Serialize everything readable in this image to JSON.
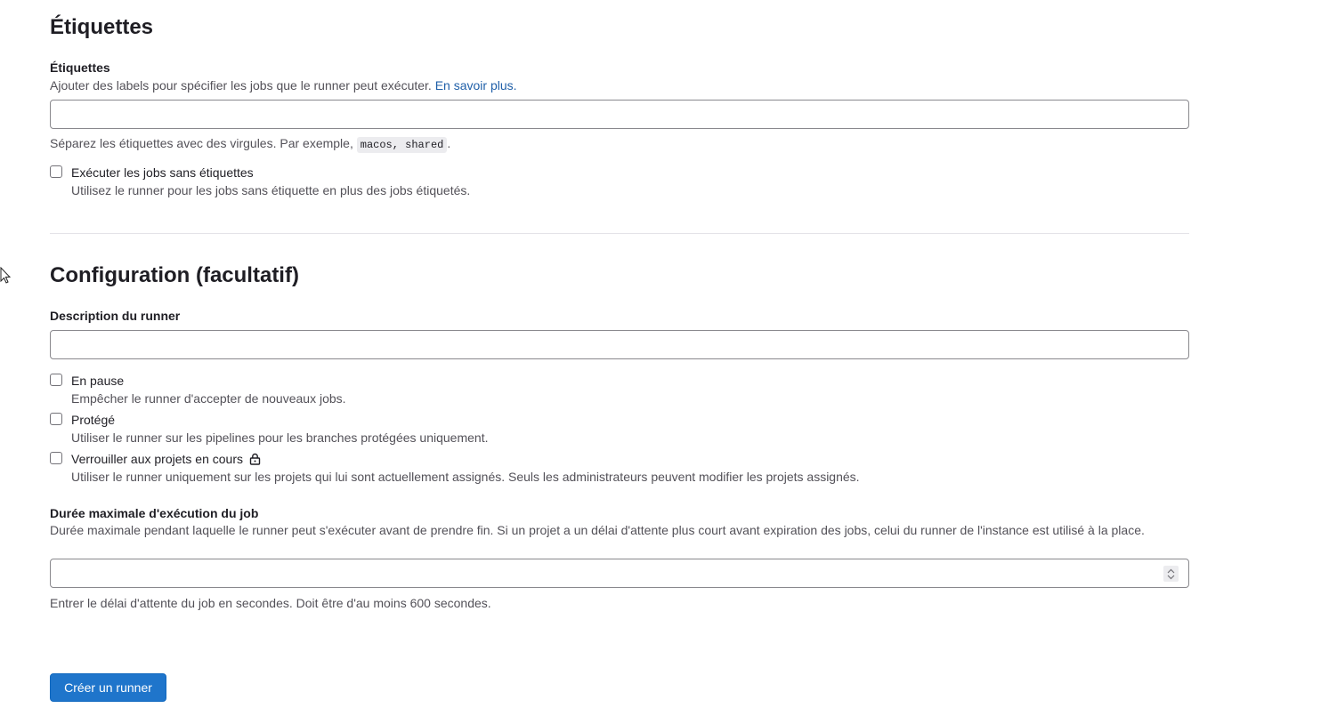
{
  "tags_section": {
    "title": "Étiquettes",
    "field_label": "Étiquettes",
    "help_text": "Ajouter des labels pour spécifier les jobs que le runner peut exécuter.",
    "help_link": "En savoir plus.",
    "input_value": "",
    "hint_prefix": "Séparez les étiquettes avec des virgules. Par exemple,",
    "hint_code": "macos, shared",
    "hint_suffix": ".",
    "run_untagged": {
      "label": "Exécuter les jobs sans étiquettes",
      "help": "Utilisez le runner pour les jobs sans étiquette en plus des jobs étiquetés.",
      "checked": false
    }
  },
  "config_section": {
    "title": "Configuration (facultatif)",
    "description_label": "Description du runner",
    "description_value": "",
    "paused": {
      "label": "En pause",
      "help": "Empêcher le runner d'accepter de nouveaux jobs.",
      "checked": false
    },
    "protected": {
      "label": "Protégé",
      "help": "Utiliser le runner sur les pipelines pour les branches protégées uniquement.",
      "checked": false
    },
    "locked": {
      "label": "Verrouiller aux projets en cours",
      "icon": "lock-icon",
      "help": "Utiliser le runner uniquement sur les projets qui lui sont actuellement assignés. Seuls les administrateurs peuvent modifier les projets assignés.",
      "checked": false
    },
    "timeout_label": "Durée maximale d'exécution du job",
    "timeout_help": "Durée maximale pendant laquelle le runner peut s'exécuter avant de prendre fin. Si un projet a un délai d'attente plus court avant expiration des jobs, celui du runner de l'instance est utilisé à la place.",
    "timeout_value": "",
    "timeout_hint": "Entrer le délai d'attente du job en secondes. Doit être d'au moins 600 secondes."
  },
  "submit_label": "Créer un runner",
  "colors": {
    "primary": "#1f75cb",
    "link": "#1f5fa8",
    "border": "#89888d"
  }
}
